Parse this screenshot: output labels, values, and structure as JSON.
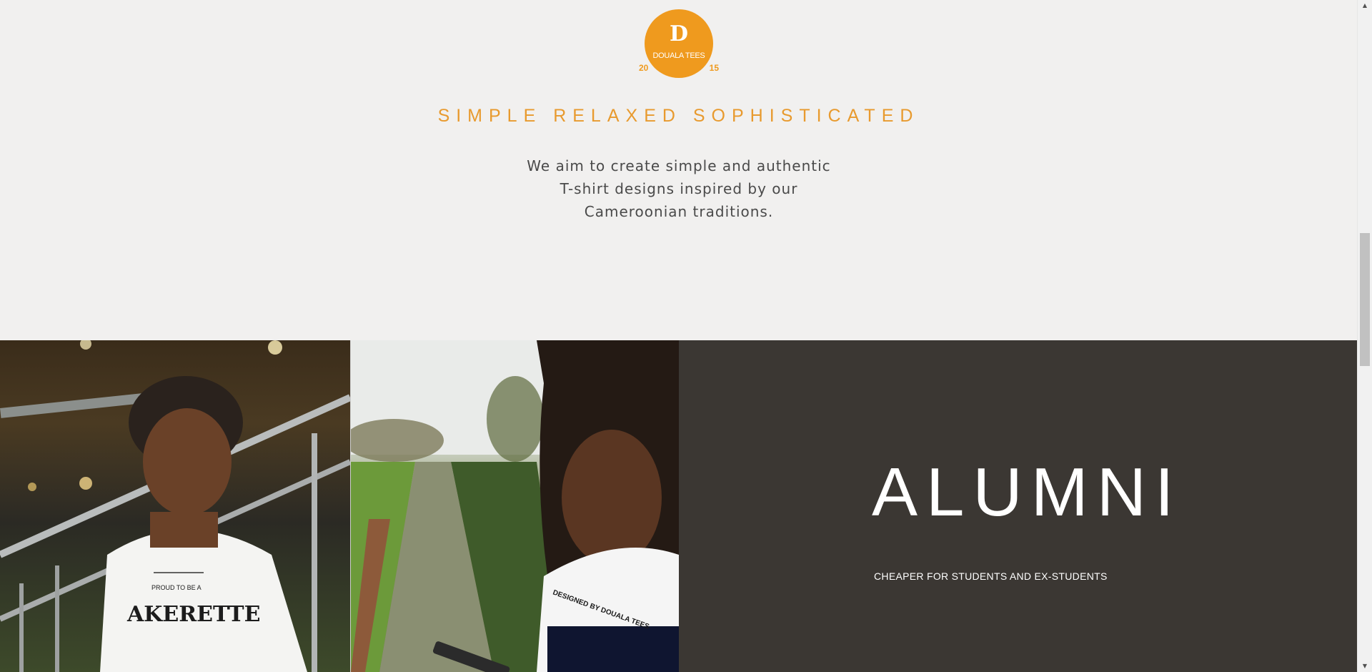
{
  "logo": {
    "letter": "D",
    "name": "DOUALA TEES",
    "year_left": "20",
    "year_right": "15",
    "color": "#ef9a1e"
  },
  "intro": {
    "tagline": "SIMPLE RELAXED SOPHISTICATED",
    "description": "We aim to create simple and authentic T-shirt designs inspired by our Cameroonian traditions."
  },
  "gallery": {
    "photo_left_shirt_text": "PROUD TO BE A AKERETTE",
    "photo_right_shirt_text": "DESIGNED BY DOUALA TEES"
  },
  "alumni": {
    "title": "ALUMNI",
    "subtitle": "CHEAPER FOR STUDENTS AND EX-STUDENTS",
    "panel_color": "#3b3733"
  },
  "scrollbar": {
    "up_icon": "scroll-up-arrow-icon",
    "down_icon": "scroll-down-arrow-icon"
  }
}
